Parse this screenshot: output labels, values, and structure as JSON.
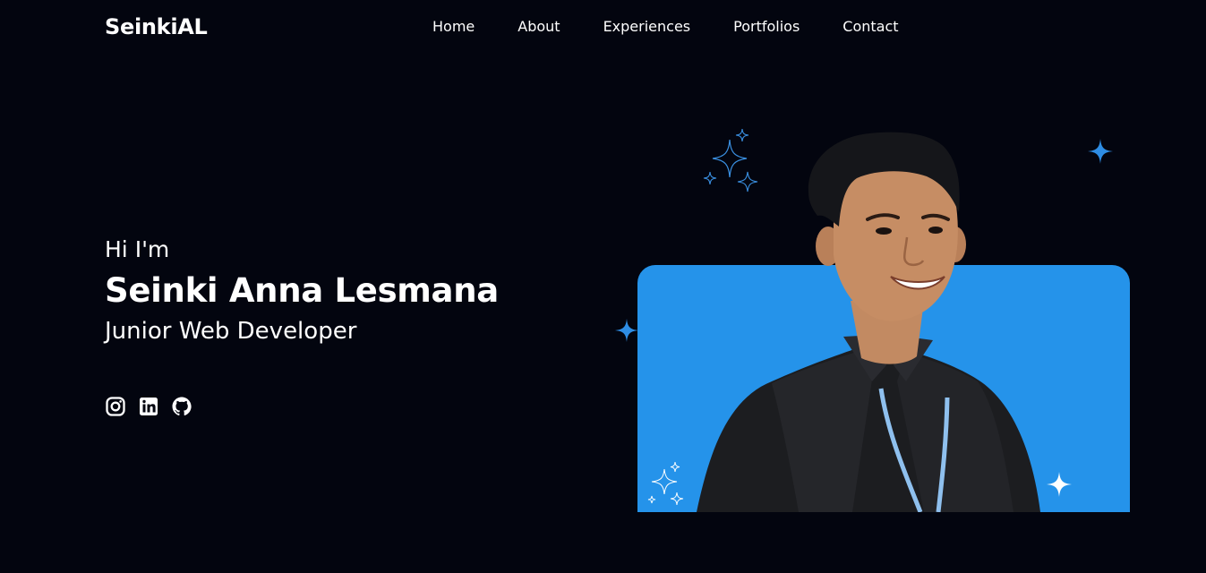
{
  "header": {
    "logo": "SeinkiAL",
    "nav": [
      "Home",
      "About",
      "Experiences",
      "Portfolios",
      "Contact"
    ]
  },
  "hero": {
    "greeting": "Hi I'm",
    "name": "Seinki Anna Lesmana",
    "role": "Junior Web Developer"
  },
  "socials": [
    {
      "icon": "instagram-icon"
    },
    {
      "icon": "linkedin-icon"
    },
    {
      "icon": "github-icon"
    }
  ],
  "colors": {
    "background": "#03050f",
    "accent": "#2593ea",
    "text": "#ffffff"
  }
}
